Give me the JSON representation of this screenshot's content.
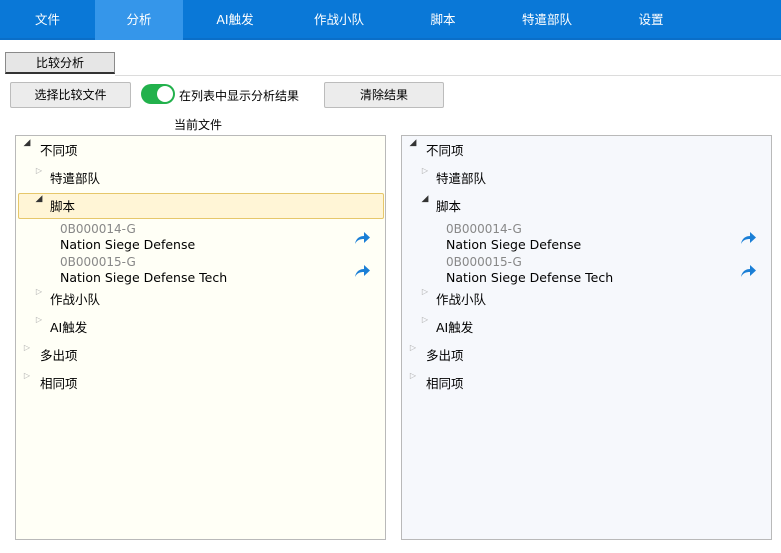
{
  "nav": {
    "tabs": [
      "文件",
      "分析",
      "AI触发",
      "作战小队",
      "脚本",
      "特遣部队",
      "设置"
    ],
    "active_index": 1
  },
  "toolbar": {
    "tab_label": "比较分析",
    "choose_button": "选择比较文件",
    "toggle_label": "在列表中显示分析结果",
    "toggle_on": true,
    "clear_button": "清除结果",
    "current_file_label": "当前文件"
  },
  "left": {
    "diff": "不同项",
    "taskforce": "特遣部队",
    "script": "脚本",
    "items": [
      {
        "id": "0B000014-G",
        "name": "Nation Siege Defense"
      },
      {
        "id": "0B000015-G",
        "name": "Nation Siege Defense Tech"
      }
    ],
    "team": "作战小队",
    "trigger": "AI触发",
    "extra": "多出项",
    "same": "相同项"
  },
  "right": {
    "diff": "不同项",
    "taskforce": "特遣部队",
    "script": "脚本",
    "items": [
      {
        "id": "0B000014-G",
        "name": "Nation Siege Defense"
      },
      {
        "id": "0B000015-G",
        "name": "Nation Siege Defense Tech"
      }
    ],
    "team": "作战小队",
    "trigger": "AI触发",
    "extra": "多出项",
    "same": "相同项"
  },
  "colors": {
    "nav_bg": "#0a78d7",
    "nav_active": "#3596ea",
    "toggle_on": "#22b14c",
    "link_arrow": "#1b7fd6"
  }
}
